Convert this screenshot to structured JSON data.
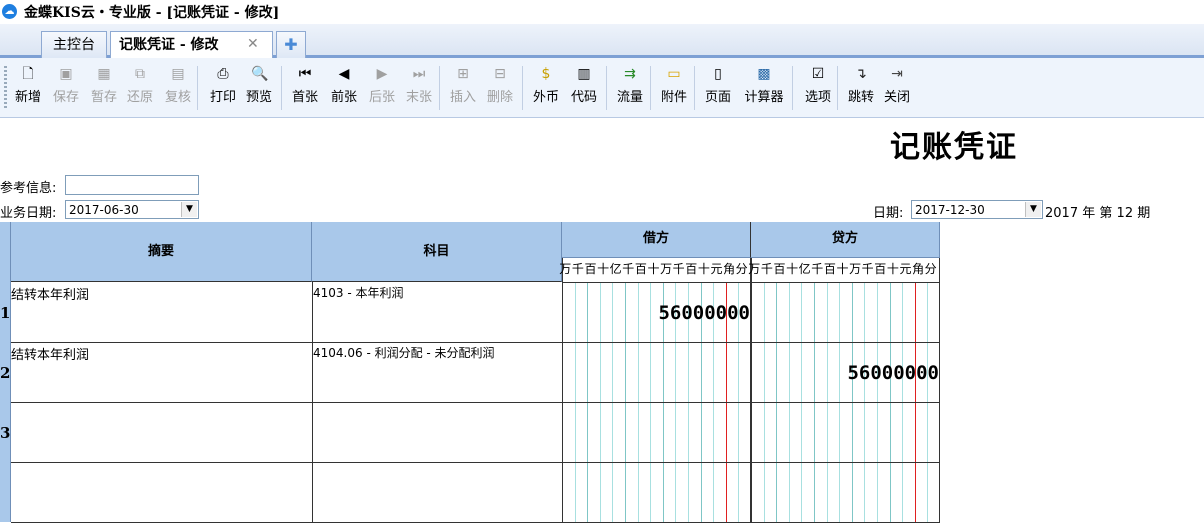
{
  "window": {
    "title": "金蝶KIS云・专业版 - [记账凭证 - 修改]"
  },
  "tabs": [
    {
      "label": "主控台"
    },
    {
      "label": "记账凭证 - 修改"
    }
  ],
  "toolbar": [
    {
      "label": "新增",
      "icon": "new-doc-icon",
      "enabled": true
    },
    {
      "label": "保存",
      "icon": "save-icon",
      "enabled": false
    },
    {
      "label": "暂存",
      "icon": "temp-save-icon",
      "enabled": false
    },
    {
      "label": "还原",
      "icon": "restore-icon",
      "enabled": false
    },
    {
      "label": "复核",
      "icon": "review-icon",
      "enabled": false
    },
    {
      "label": "打印",
      "icon": "print-icon",
      "enabled": true
    },
    {
      "label": "预览",
      "icon": "preview-icon",
      "enabled": true
    },
    {
      "label": "首张",
      "icon": "first-icon",
      "enabled": true
    },
    {
      "label": "前张",
      "icon": "prev-icon",
      "enabled": true
    },
    {
      "label": "后张",
      "icon": "next-icon",
      "enabled": false
    },
    {
      "label": "末张",
      "icon": "last-icon",
      "enabled": false
    },
    {
      "label": "插入",
      "icon": "insert-row-icon",
      "enabled": false
    },
    {
      "label": "删除",
      "icon": "delete-row-icon",
      "enabled": false
    },
    {
      "label": "外币",
      "icon": "currency-icon",
      "enabled": true
    },
    {
      "label": "代码",
      "icon": "code-icon",
      "enabled": true
    },
    {
      "label": "流量",
      "icon": "cashflow-icon",
      "enabled": true
    },
    {
      "label": "附件",
      "icon": "attachment-icon",
      "enabled": true
    },
    {
      "label": "页面",
      "icon": "page-icon",
      "enabled": true
    },
    {
      "label": "计算器",
      "icon": "calculator-icon",
      "enabled": true
    },
    {
      "label": "选项",
      "icon": "options-icon",
      "enabled": true
    },
    {
      "label": "跳转",
      "icon": "jump-icon",
      "enabled": true
    },
    {
      "label": "关闭",
      "icon": "close-door-icon",
      "enabled": true
    }
  ],
  "voucher": {
    "title": "记账凭证",
    "ref_label": "参考信息:",
    "ref_value": "",
    "biz_date_label": "业务日期:",
    "biz_date": "2017-06-30",
    "date_label": "日期:",
    "date": "2017-12-30",
    "period_year": "2017",
    "period_year_unit": "年",
    "period_prefix": "第",
    "period": "12",
    "period_unit": "期"
  },
  "grid": {
    "headers": {
      "summary": "摘要",
      "account": "科目",
      "debit": "借方",
      "credit": "贷方"
    },
    "digit_headers": [
      "万",
      "千",
      "百",
      "十",
      "亿",
      "千",
      "百",
      "十",
      "万",
      "千",
      "百",
      "十",
      "元",
      "角",
      "分"
    ],
    "rows": [
      {
        "no": "1",
        "summary": "结转本年利润",
        "account": "4103 - 本年利润",
        "debit": "56000000",
        "credit": ""
      },
      {
        "no": "2",
        "summary": "结转本年利润",
        "account": "4104.06 - 利润分配 - 未分配利润",
        "debit": "",
        "credit": "56000000"
      },
      {
        "no": "3",
        "summary": "",
        "account": "",
        "debit": "",
        "credit": ""
      },
      {
        "no": "",
        "summary": "",
        "account": "",
        "debit": "",
        "credit": ""
      }
    ]
  }
}
